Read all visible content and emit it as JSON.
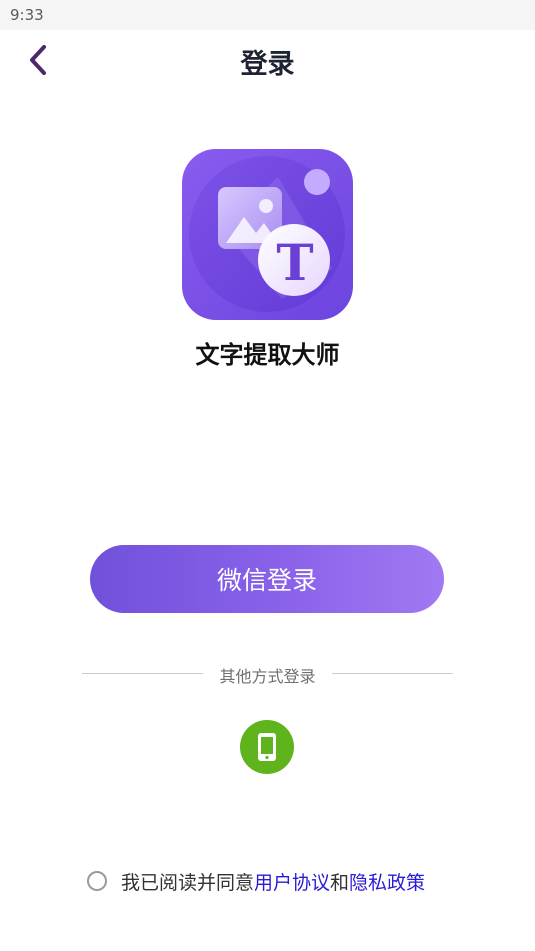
{
  "status_bar": {
    "time": "9:33"
  },
  "header": {
    "title": "登录",
    "back_icon": "chevron-left-icon"
  },
  "app": {
    "name": "文字提取大师",
    "logo_letter": "T",
    "logo_icon": "image-text-logo-icon"
  },
  "login": {
    "wechat_label": "微信登录",
    "other_methods_label": "其他方式登录",
    "phone_icon": "mobile-phone-icon"
  },
  "agreement": {
    "prefix": "我已阅读并同意",
    "user_agreement": "用户协议",
    "joiner": "和",
    "privacy_policy": "隐私政策"
  },
  "colors": {
    "accent_purple": "#7b57e4",
    "phone_green": "#5fb31c",
    "link_blue": "#2a1bd6",
    "title_dark": "#1d2330"
  }
}
